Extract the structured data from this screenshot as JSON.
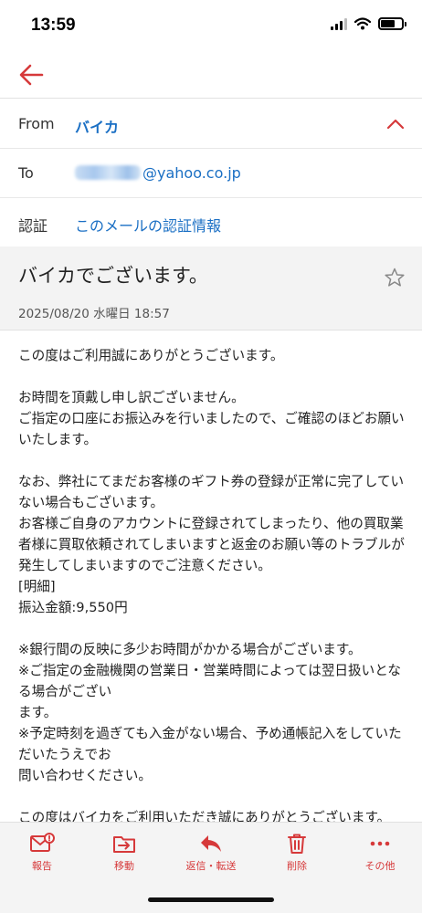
{
  "status_bar": {
    "time": "13:59"
  },
  "headers": {
    "from_label": "From",
    "from_value": "バイカ",
    "to_label": "To",
    "to_value": "@yahoo.co.jp",
    "auth_label": "認証",
    "auth_value": "このメールの認証情報"
  },
  "message": {
    "subject": "バイカでございます。",
    "date": "2025/08/20 水曜日 18:57",
    "paragraphs": [
      "この度はご利用誠にありがとうございます。",
      "お時間を頂戴し申し訳ございません。\nご指定の口座にお振込みを行いましたので、ご確認のほどお願いいたします。",
      "なお、弊社にてまだお客様のギフト券の登録が正常に完了していない場合もございます。\nお客様ご自身のアカウントに登録されてしまったり、他の買取業者様に買取依頼されてしまいますと返金のお願い等のトラブルが発生してしまいますのでご注意ください。\n[明細]\n振込金額:9,550円",
      "※銀行間の反映に多少お時間がかかる場合がございます。\n※ご指定の金融機関の営業日・営業時間によっては翌日扱いとなる場合がござい\nます。\n※予定時刻を過ぎても入金がない場合、予め通帳記入をしていただいたうえでお\n問い合わせください。",
      "この度はバイカをご利用いただき誠にありがとうございます。"
    ]
  },
  "toolbar": {
    "report": "報告",
    "move": "移動",
    "reply": "返信・転送",
    "delete": "削除",
    "more": "その他"
  },
  "colors": {
    "accent": "#d6393a",
    "link": "#1a6fc4"
  }
}
